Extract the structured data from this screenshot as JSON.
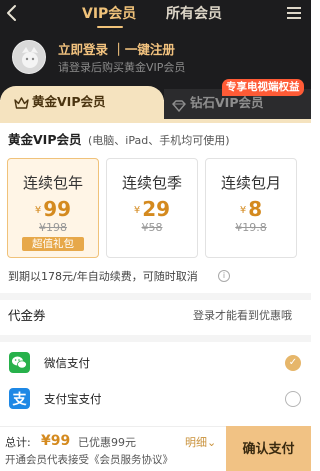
{
  "header": {
    "back_icon": "chevron-left-icon",
    "tabs": [
      {
        "label": "VIP会员",
        "active": true
      },
      {
        "label": "所有会员",
        "active": false
      }
    ],
    "menu_icon": "hamburger-menu-icon",
    "accent_color": "#f0c27a"
  },
  "login": {
    "title": "立即登录 ｜一键注册",
    "subtitle": "请登录后购买黄金VIP会员"
  },
  "levels": {
    "gold_label": "黄金VIP会员",
    "diamond_label": "钻石VIP会员",
    "diamond_badge": "专享电视端权益"
  },
  "plans_section": {
    "title": "黄金VIP会员",
    "subtitle": "(电脑、iPad、手机均可使用)",
    "plans": [
      {
        "name": "连续包年",
        "currency": "¥",
        "price": "99",
        "original": "¥198",
        "tag": "超值礼包",
        "selected": true
      },
      {
        "name": "连续包季",
        "currency": "¥",
        "price": "29",
        "original": "¥58",
        "tag": "",
        "selected": false
      },
      {
        "name": "连续包月",
        "currency": "¥",
        "price": "8",
        "original": "¥19.8",
        "tag": "",
        "selected": false
      }
    ],
    "auto_renew_note": "到期以178元/年自动续费，可随时取消"
  },
  "coupon": {
    "label": "代金券",
    "hint": "登录才能看到优惠哦"
  },
  "payment": {
    "methods": [
      {
        "label": "微信支付",
        "icon": "wechat-pay-icon",
        "selected": true
      },
      {
        "label": "支付宝支付",
        "icon": "alipay-icon",
        "selected": false
      }
    ]
  },
  "footer": {
    "total_label": "总计:",
    "total_price": "¥99",
    "discount": "已优惠99元",
    "detail_link": "明细⌄",
    "agreement": "开通会员代表接受《会员服务协议》",
    "confirm_label": "确认支付"
  }
}
